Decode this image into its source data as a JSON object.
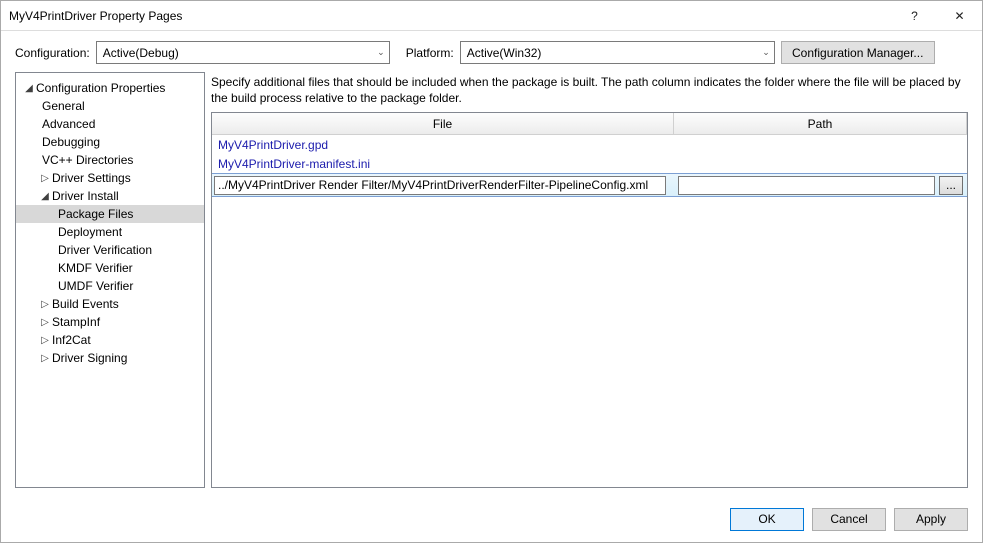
{
  "window": {
    "title": "MyV4PrintDriver Property Pages"
  },
  "configRow": {
    "configurationLabel": "Configuration:",
    "configurationValue": "Active(Debug)",
    "platformLabel": "Platform:",
    "platformValue": "Active(Win32)",
    "managerButton": "Configuration Manager..."
  },
  "tree": {
    "root": "Configuration Properties",
    "items": [
      {
        "label": "General"
      },
      {
        "label": "Advanced"
      },
      {
        "label": "Debugging"
      },
      {
        "label": "VC++ Directories"
      },
      {
        "label": "Driver Settings",
        "expandable": true,
        "expanded": false
      },
      {
        "label": "Driver Install",
        "expandable": true,
        "expanded": true,
        "children": [
          {
            "label": "Package Files",
            "selected": true
          },
          {
            "label": "Deployment"
          },
          {
            "label": "Driver Verification"
          },
          {
            "label": "KMDF Verifier"
          },
          {
            "label": "UMDF Verifier"
          }
        ]
      },
      {
        "label": "Build Events",
        "expandable": true,
        "expanded": false
      },
      {
        "label": "StampInf",
        "expandable": true,
        "expanded": false
      },
      {
        "label": "Inf2Cat",
        "expandable": true,
        "expanded": false
      },
      {
        "label": "Driver Signing",
        "expandable": true,
        "expanded": false
      }
    ]
  },
  "description": "Specify additional files that should be included when the package is built.  The path column indicates the folder where the file will be placed by the build process relative to the package folder.",
  "grid": {
    "columns": {
      "file": "File",
      "path": "Path"
    },
    "rows": [
      {
        "file": "MyV4PrintDriver.gpd",
        "path": ""
      },
      {
        "file": "MyV4PrintDriver-manifest.ini",
        "path": ""
      }
    ],
    "editing": {
      "file": "../MyV4PrintDriver Render Filter/MyV4PrintDriverRenderFilter-PipelineConfig.xml",
      "path": "",
      "browse": "..."
    }
  },
  "footer": {
    "ok": "OK",
    "cancel": "Cancel",
    "apply": "Apply"
  },
  "glyphs": {
    "help": "?",
    "close": "✕",
    "chevDown": "⌄",
    "triRight": "▷",
    "triDown": "◢"
  }
}
